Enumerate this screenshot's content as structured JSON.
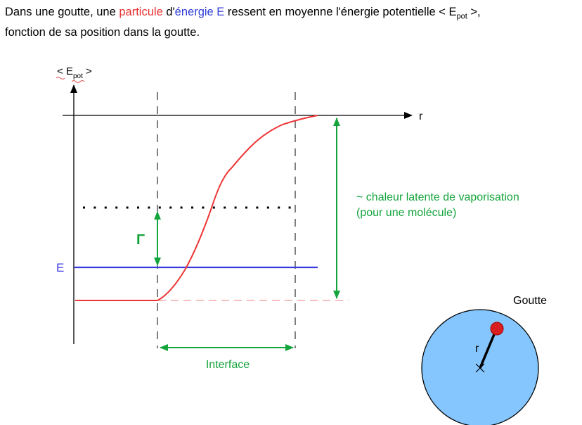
{
  "intro": {
    "part1": "Dans une goutte, une ",
    "particule": "particule",
    "part2": " d'",
    "energie_e": "énergie E",
    "part3": " ressent en moyenne l'énergie potentielle < ",
    "epot_main": "E",
    "epot_sub": "pot",
    "part4": " >,",
    "line2": "fonction de sa position dans la goutte."
  },
  "diagram": {
    "y_axis_label_open": "< ",
    "y_axis_label_main": "E",
    "y_axis_label_sub": "pot",
    "y_axis_label_close": " >",
    "x_axis_label": "r",
    "energy_label": "E",
    "gamma_label": "Γ",
    "latent_heat_line1": "~ chaleur latente de vaporisation",
    "latent_heat_line2": "(pour une molécule)",
    "interface_label": "Interface",
    "drop_title": "Goutte",
    "drop_radius_label": "r"
  },
  "colors": {
    "curve": "#ee3535",
    "energy_level": "#3b3be0",
    "green_annotations": "#14a43c",
    "drop_fill": "#85c6ff",
    "particle": "#d81e1e",
    "dashed_baseline": "#f29a9a"
  }
}
